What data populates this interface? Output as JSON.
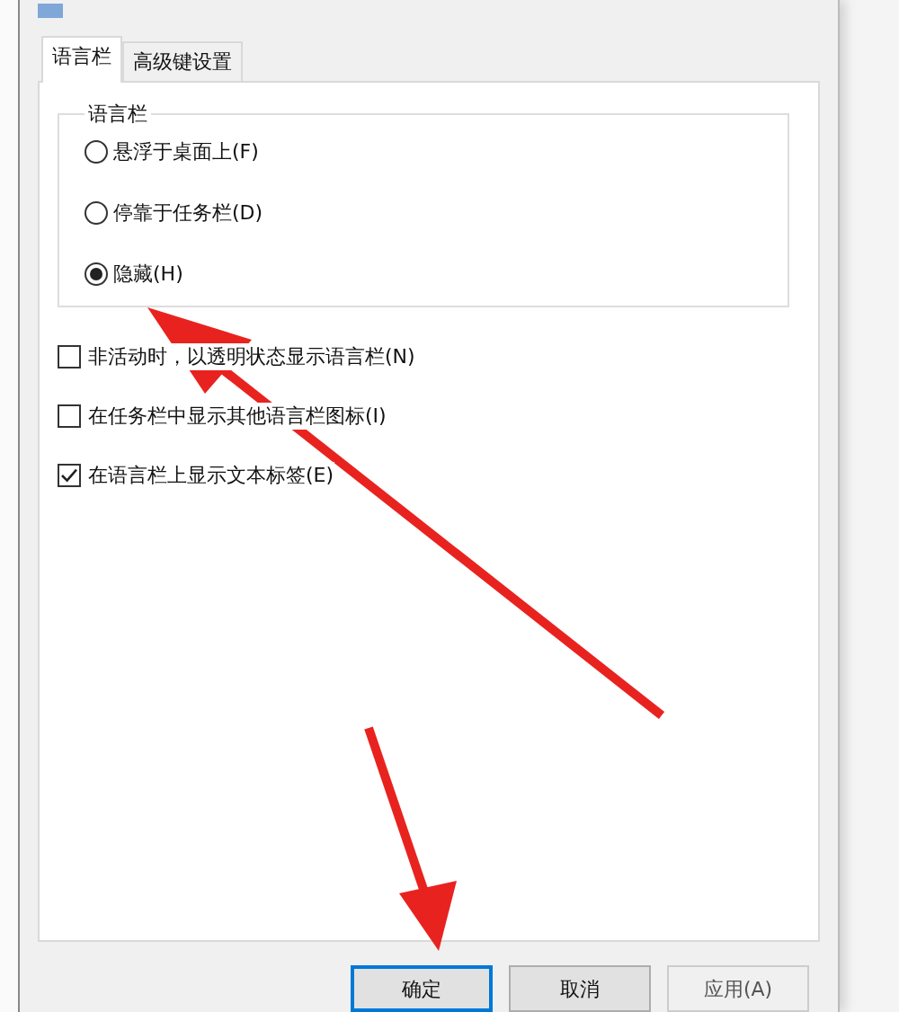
{
  "tabs": [
    {
      "label": "语言栏",
      "selected": true
    },
    {
      "label": "高级键设置",
      "selected": false
    }
  ],
  "group": {
    "title": "语言栏",
    "options": [
      {
        "label": "悬浮于桌面上(F)",
        "selected": false
      },
      {
        "label": "停靠于任务栏(D)",
        "selected": false
      },
      {
        "label": "隐藏(H)",
        "selected": true
      }
    ]
  },
  "checkboxes": [
    {
      "label": "非活动时，以透明状态显示语言栏(N)",
      "checked": false
    },
    {
      "label": "在任务栏中显示其他语言栏图标(I)",
      "checked": false
    },
    {
      "label": "在语言栏上显示文本标签(E)",
      "checked": true
    }
  ],
  "buttons": [
    {
      "label": "确定",
      "kind": "default"
    },
    {
      "label": "取消",
      "kind": "normal"
    },
    {
      "label": "应用(A)",
      "kind": "disabled"
    }
  ]
}
